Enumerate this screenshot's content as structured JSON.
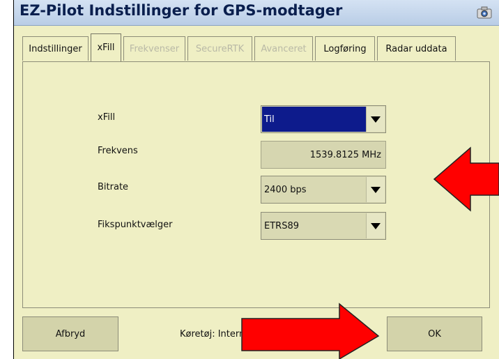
{
  "window": {
    "title": "EZ-Pilot Indstillinger for GPS-modtager",
    "title_icon": "camera-icon"
  },
  "tabs": [
    {
      "label": "Indstillinger",
      "state": "enabled"
    },
    {
      "label": "xFill",
      "state": "active"
    },
    {
      "label": "Frekvenser",
      "state": "disabled"
    },
    {
      "label": "SecureRTK",
      "state": "disabled"
    },
    {
      "label": "Avanceret",
      "state": "disabled"
    },
    {
      "label": "Logføring",
      "state": "enabled"
    },
    {
      "label": "Radar uddata",
      "state": "enabled"
    }
  ],
  "form": {
    "xfill_label": "xFill",
    "xfill_value": "Til",
    "frequency_label": "Frekvens",
    "frequency_value": "1539.8125 MHz",
    "bitrate_label": "Bitrate",
    "bitrate_value": "2400 bps",
    "datum_label": "Fikspunktvælger",
    "datum_value": "ETRS89"
  },
  "footer": {
    "cancel_label": "Afbryd",
    "status_text": "Køretøj: Intern",
    "ok_label": "OK"
  },
  "colors": {
    "panel_bg": "#efefc4",
    "selection": "#0d1b8c",
    "title_bg": "#c6d7ec",
    "arrow": "#ff0000"
  }
}
